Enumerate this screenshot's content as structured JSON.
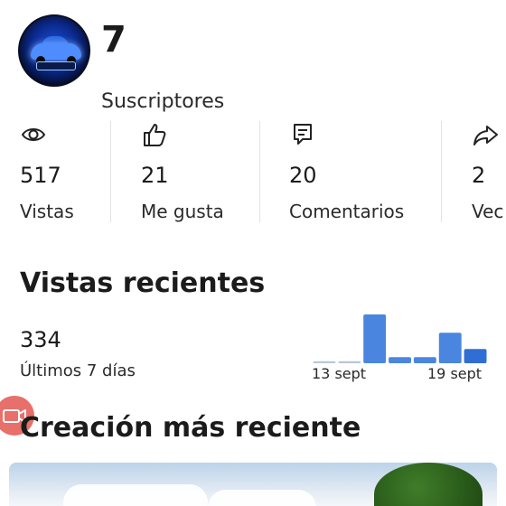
{
  "channel": {
    "subscriber_count": "7",
    "subscriber_label": "Suscriptores"
  },
  "stats": [
    {
      "icon": "eye-icon",
      "value": "517",
      "label": "Vistas"
    },
    {
      "icon": "thumbs-up-icon",
      "value": "21",
      "label": "Me gusta"
    },
    {
      "icon": "comment-icon",
      "value": "20",
      "label": "Comentarios"
    },
    {
      "icon": "share-icon",
      "value": "2",
      "label": "Vec"
    }
  ],
  "recent_views": {
    "title": "Vistas recientes",
    "value": "334",
    "period_label": "Últimos 7 días",
    "date_start": "13 sept",
    "date_end": "19 sept"
  },
  "chart_data": {
    "type": "bar",
    "values": [
      0.5,
      0.5,
      12,
      1.5,
      1.5,
      7.5,
      3.5
    ],
    "ylim": [
      0,
      12
    ],
    "colors": [
      "#bcc7d6",
      "#bcc7d6",
      "#4a86e0",
      "#4a86e0",
      "#4a86e0",
      "#4a86e0",
      "#2f6fd4"
    ]
  },
  "latest_creation": {
    "title": "Creación más reciente"
  },
  "colors": {
    "accent": "#4a86e0",
    "fab": "#e8706a"
  }
}
